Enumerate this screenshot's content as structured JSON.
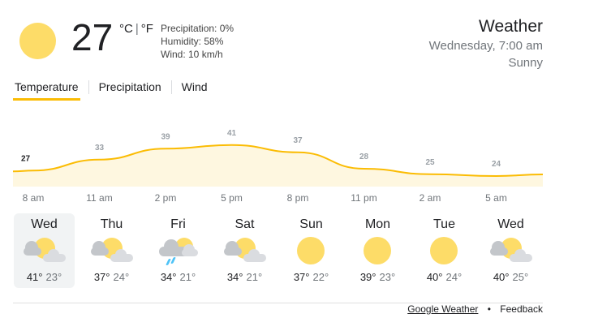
{
  "current": {
    "temp": "27",
    "unit_c": "°C",
    "unit_sep": "|",
    "unit_f": "°F",
    "precipitation": "Precipitation: 0%",
    "humidity": "Humidity: 58%",
    "wind": "Wind: 10 km/h",
    "icon": "sunny-icon"
  },
  "header": {
    "title": "Weather",
    "datetime": "Wednesday, 7:00 am",
    "condition": "Sunny"
  },
  "tabs": [
    "Temperature",
    "Precipitation",
    "Wind"
  ],
  "chart_data": {
    "type": "area",
    "x": [
      "8 am",
      "11 am",
      "2 pm",
      "5 pm",
      "8 pm",
      "11 pm",
      "2 am",
      "5 am"
    ],
    "values": [
      27,
      33,
      39,
      41,
      37,
      28,
      25,
      24
    ],
    "labels": [
      "27",
      "33",
      "39",
      "41",
      "37",
      "28",
      "25",
      "24"
    ],
    "color": "#fbbc04",
    "fill": "#fef7e0"
  },
  "forecast": [
    {
      "day": "Wed",
      "high": "41°",
      "low": "23°",
      "icon": "partly-cloudy-icon"
    },
    {
      "day": "Thu",
      "high": "37°",
      "low": "24°",
      "icon": "partly-cloudy-icon"
    },
    {
      "day": "Fri",
      "high": "34°",
      "low": "21°",
      "icon": "rain-cloud-icon"
    },
    {
      "day": "Sat",
      "high": "34°",
      "low": "21°",
      "icon": "partly-cloudy-icon"
    },
    {
      "day": "Sun",
      "high": "37°",
      "low": "22°",
      "icon": "sunny-icon"
    },
    {
      "day": "Mon",
      "high": "39°",
      "low": "23°",
      "icon": "sunny-icon"
    },
    {
      "day": "Tue",
      "high": "40°",
      "low": "24°",
      "icon": "sunny-icon"
    },
    {
      "day": "Wed",
      "high": "40°",
      "low": "25°",
      "icon": "partly-cloudy-icon"
    }
  ],
  "footer": {
    "source": "Google Weather",
    "separator": "•",
    "feedback": "Feedback"
  }
}
